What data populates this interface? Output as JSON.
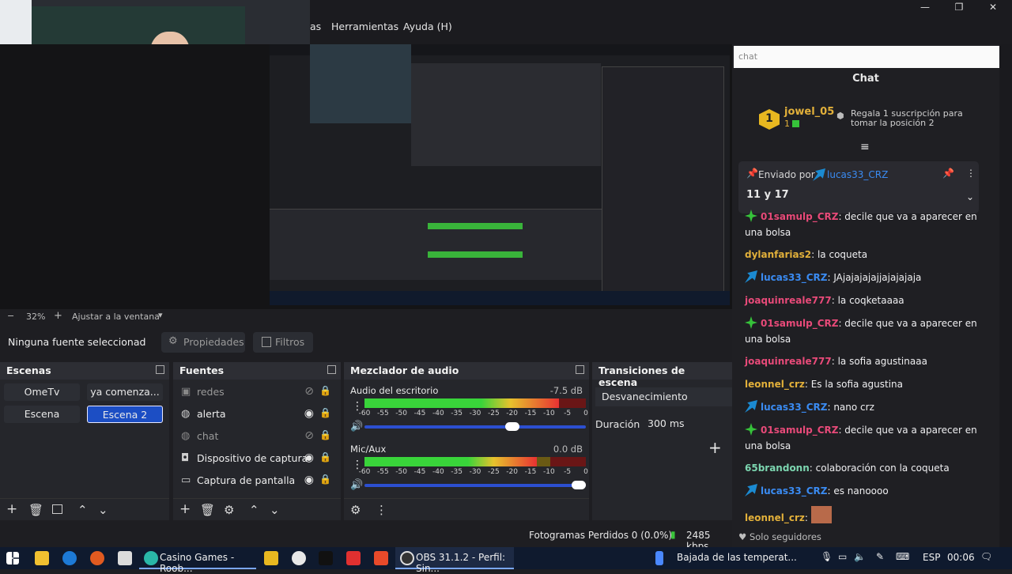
{
  "menu": {
    "item_partial": "as",
    "tools": "Herramientas",
    "help": "Ayuda (H)"
  },
  "window_controls": {
    "minimize": "—",
    "maximize": "❐",
    "close": "✕"
  },
  "preview": {
    "zoom": "32%",
    "fit": "Ajustar a la ventana"
  },
  "source_bar": {
    "selected": "Ninguna fuente seleccionad",
    "properties": "Propiedades",
    "filters": "Filtros"
  },
  "scenes": {
    "title": "Escenas",
    "items": [
      {
        "label": "OmeTv",
        "selected": false
      },
      {
        "label": "ya comenza...",
        "selected": false
      },
      {
        "label": "Escena",
        "selected": false
      },
      {
        "label": "Escena 2",
        "selected": true
      }
    ]
  },
  "sources": {
    "title": "Fuentes",
    "items": [
      {
        "label": "redes",
        "icon": "browser-icon",
        "visible": false
      },
      {
        "label": "alerta",
        "icon": "globe-icon",
        "visible": true
      },
      {
        "label": "chat",
        "icon": "globe-icon",
        "visible": false
      },
      {
        "label": "Dispositivo de captura",
        "icon": "camera-icon",
        "visible": true
      },
      {
        "label": "Captura de pantalla",
        "icon": "monitor-icon",
        "visible": true
      }
    ]
  },
  "mixer": {
    "title": "Mezclador de audio",
    "ticks": [
      "-60",
      "-55",
      "-50",
      "-45",
      "-40",
      "-35",
      "-30",
      "-25",
      "-20",
      "-15",
      "-10",
      "-5",
      "0"
    ],
    "channels": [
      {
        "label": "Audio del escritorio",
        "db": "-7.5 dB",
        "level": 0.88,
        "volume": 0.7
      },
      {
        "label": "Mic/Aux",
        "db": "0.0 dB",
        "level": 0.78,
        "volume": 1.0
      }
    ]
  },
  "transitions": {
    "title": "Transiciones de escena",
    "type": "Desvanecimiento",
    "duration_label": "Duración",
    "duration": "300 ms"
  },
  "status": {
    "frames": "Fotogramas Perdidos 0 (0.0%)",
    "kbps": "2485 kbps"
  },
  "chat": {
    "search_placeholder": "chat",
    "title": "Chat",
    "gift": {
      "rank": "1",
      "user": "jowel_05",
      "count": "1",
      "text": "Regala 1 suscripción para tomar la posición 2"
    },
    "pinned": {
      "sent_by": "Enviado por",
      "user": "lucas33_CRZ",
      "text": "11 y 17"
    },
    "messages": [
      {
        "user": "01samulp_CRZ",
        "text": "decile que va a aparecer en una bolsa",
        "color": "#e84a79",
        "badge": "sub"
      },
      {
        "user": "dylanfarias2",
        "text": "la coqueta",
        "color": "#e2b03a",
        "badge": ""
      },
      {
        "user": "lucas33_CRZ",
        "text": "JAjajajajajjajajajaja",
        "color": "#3a8bf2",
        "badge": "prime"
      },
      {
        "user": "joaquinreale777",
        "text": "la coqketaaaa",
        "color": "#e84a79",
        "badge": ""
      },
      {
        "user": "01samulp_CRZ",
        "text": "decile que va a aparecer en una bolsa",
        "color": "#e84a79",
        "badge": "sub"
      },
      {
        "user": "joaquinreale777",
        "text": "la sofia agustinaaa",
        "color": "#e84a79",
        "badge": ""
      },
      {
        "user": "leonnel_crz",
        "text": "Es la sofia agustina",
        "color": "#e2b03a",
        "badge": ""
      },
      {
        "user": "lucas33_CRZ",
        "text": "nano crz",
        "color": "#3a8bf2",
        "badge": "prime"
      },
      {
        "user": "01samulp_CRZ",
        "text": "decile que va a aparecer en una bolsa",
        "color": "#e84a79",
        "badge": "sub"
      },
      {
        "user": "65brandonn",
        "text": "colaboración con la coqueta",
        "color": "#7cd6b0",
        "badge": ""
      },
      {
        "user": "lucas33_CRZ",
        "text": "es nanoooo",
        "color": "#3a8bf2",
        "badge": "prime"
      },
      {
        "user": "leonnel_crz",
        "text": "",
        "color": "#e2b03a",
        "badge": ""
      }
    ],
    "footer": "Solo seguidores"
  },
  "taskbar": {
    "apps": [
      {
        "label": "Casino Games - Roob..."
      },
      {
        "label": "OBS 31.1.2 - Perfil: Sin..."
      }
    ],
    "news": "Bajada de las temperat...",
    "lang": "ESP",
    "time": "00:06"
  }
}
